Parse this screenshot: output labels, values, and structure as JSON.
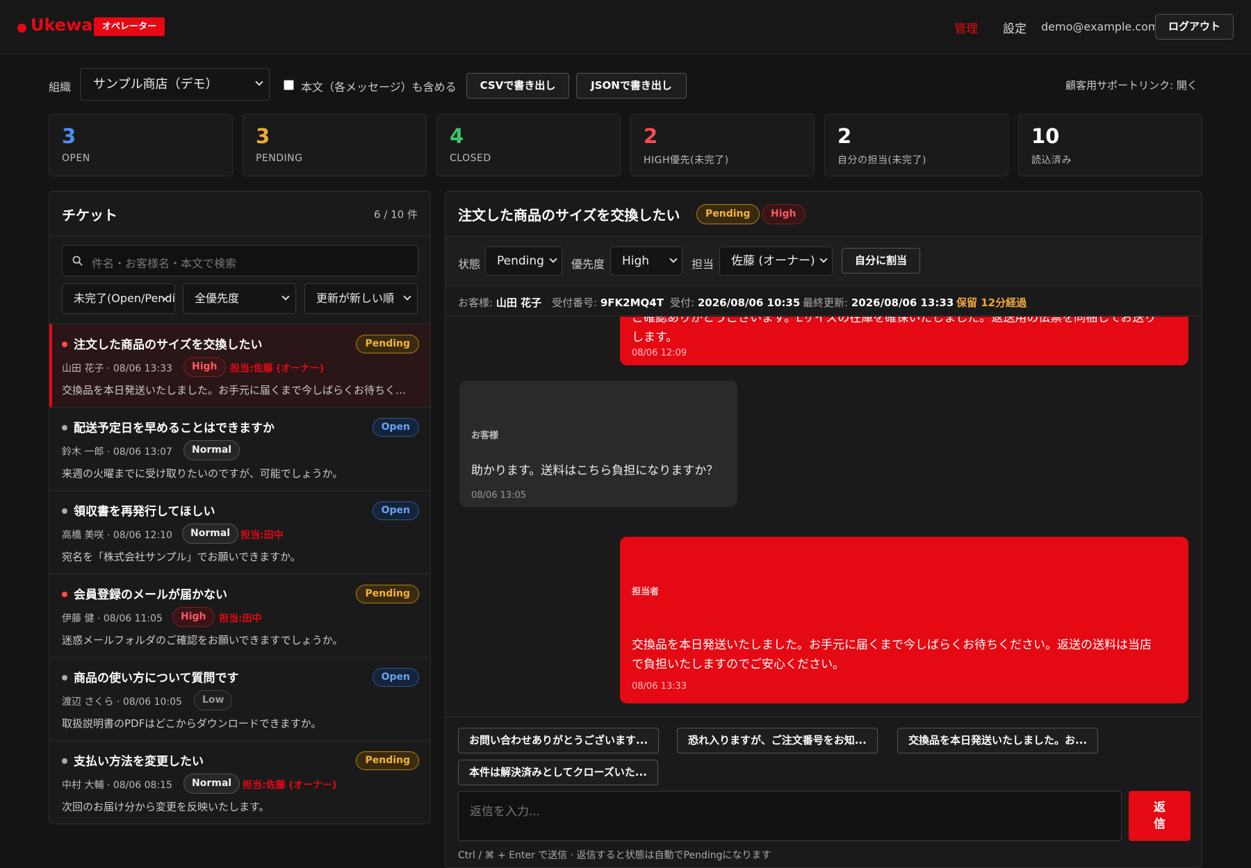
{
  "header": {
    "logo": "Ukewa",
    "role_badge": "オペレーター",
    "nav_admin": "管理",
    "nav_settings": "設定",
    "email": "demo@example.com",
    "logout": "ログアウト"
  },
  "toolbar": {
    "org_label": "組織",
    "org_value": "サンプル商店（デモ）",
    "include_body_label": "本文（各メッセージ）も含める",
    "include_body_checked": false,
    "csv_button": "CSVで書き出し",
    "json_button": "JSONで書き出し",
    "support_link": "顧客用サポートリンク: 開く"
  },
  "stats": [
    {
      "value": "3",
      "label": "OPEN",
      "color": "#4a90f0"
    },
    {
      "value": "3",
      "label": "PENDING",
      "color": "#f2a83a"
    },
    {
      "value": "4",
      "label": "CLOSED",
      "color": "#3cc46a"
    },
    {
      "value": "2",
      "label": "HIGH優先(未完了)",
      "color": "#ff4a50"
    },
    {
      "value": "2",
      "label": "自分の担当(未完了)",
      "color": "#ffffff"
    },
    {
      "value": "10",
      "label": "読込済み",
      "color": "#ffffff"
    }
  ],
  "ticket_list": {
    "title": "チケット",
    "count": "6 / 10 件",
    "search_placeholder": "件名・お客様名・本文で検索",
    "filter_status": "未完了(Open/Pending)",
    "filter_priority": "全優先度",
    "sort": "更新が新しい順",
    "tickets": [
      {
        "title": "注文した商品のサイズを交換したい",
        "customer": "山田 花子",
        "time": "08/06 13:33",
        "priority": "High",
        "assignee": "担当:佐藤 (オーナー)",
        "preview": "交換品を本日発送いたしました。お手元に届くまで今しばらくお待ちください。",
        "status": "Pending",
        "dot_color": "#ff4a50"
      },
      {
        "title": "配送予定日を早めることはできますか",
        "customer": "鈴木 一郎",
        "time": "08/06 13:07",
        "priority": "Normal",
        "assignee": "",
        "preview": "来週の火曜までに受け取りたいのですが、可能でしょうか。",
        "status": "Open",
        "dot_color": "#aaaaaa"
      },
      {
        "title": "領収書を再発行してほしい",
        "customer": "高橋 美咲",
        "time": "08/06 12:10",
        "priority": "Normal",
        "assignee": "担当:田中",
        "preview": "宛名を「株式会社サンプル」でお願いできますか。",
        "status": "Open",
        "dot_color": "#aaaaaa"
      },
      {
        "title": "会員登録のメールが届かない",
        "customer": "伊藤 健",
        "time": "08/06 11:05",
        "priority": "High",
        "assignee": "担当:田中",
        "preview": "迷惑メールフォルダのご確認をお願いできますでしょうか。",
        "status": "Pending",
        "dot_color": "#ff4a50"
      },
      {
        "title": "商品の使い方について質問です",
        "customer": "渡辺 さくら",
        "time": "08/06 10:05",
        "priority": "Low",
        "assignee": "",
        "preview": "取扱説明書のPDFはどこからダウンロードできますか。",
        "status": "Open",
        "dot_color": "#aaaaaa"
      },
      {
        "title": "支払い方法を変更したい",
        "customer": "中村 大輔",
        "time": "08/06 08:15",
        "priority": "Normal",
        "assignee": "担当:佐藤 (オーナー)",
        "preview": "次回のお届け分から変更を反映いたします。",
        "status": "Pending",
        "dot_color": "#aaaaaa"
      }
    ]
  },
  "detail": {
    "title": "注文した商品のサイズを交換したい",
    "status_badge": "Pending",
    "priority_badge": "High",
    "status_label": "状態",
    "status_value": "Pending",
    "priority_label": "優先度",
    "priority_value": "High",
    "assignee_label": "担当",
    "assignee_value": "佐藤 (オーナー)",
    "assign_me_button": "自分に割当",
    "customer_label": "お客様:",
    "customer_value": "山田 花子",
    "receipt_label": "受付番号:",
    "receipt_value": "9FK2MQ4T",
    "received_label": "受付:",
    "received_value": "2026/08/06 10:35",
    "updated_label": "最終更新:",
    "updated_value": "2026/08/06 13:33",
    "hold_text": "保留 12分経過",
    "messages": [
      {
        "sender": "",
        "text_line1": "ご確認ありがとうございます。Lサイズの在庫を確保いたしました。返送用の伝票を同梱してお送り",
        "text_line2": "します。",
        "time": "08/06 12:09"
      },
      {
        "sender": "お客様",
        "text": "助かります。送料はこちら負担になりますか？",
        "time": "08/06 13:05"
      },
      {
        "sender": "担当者",
        "text_line1": "交換品を本日発送いたしました。お手元に届くまで今しばらくお待ちください。返送の送料は当店",
        "text_line2": "で負担いたしますのでご安心ください。",
        "time": "08/06 13:33"
      }
    ],
    "templates": [
      "お問い合わせありがとうございます...",
      "恐れ入りますが、ご注文番号をお知...",
      "交換品を本日発送いたしました。お...",
      "本件は解決済みとしてクローズいた..."
    ],
    "reply_placeholder": "返信を入力...",
    "send_button": "返信",
    "hint": "Ctrl / ⌘ + Enter で送信 · 返信すると状態は自動でPendingになります"
  }
}
